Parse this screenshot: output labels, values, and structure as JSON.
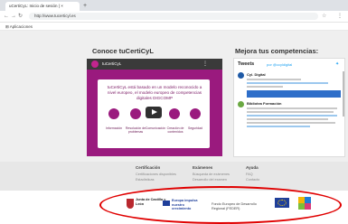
{
  "browser": {
    "tab_title": "uCertiCyL: Inicio de sesión | ×",
    "url": "http://www.tucerticyl.es",
    "bookmarks_label": "Aplicaciones"
  },
  "page": {
    "left_heading": "Conoce tuCertiCyL",
    "right_heading": "Mejora tus competencias:"
  },
  "video": {
    "channel": "tuCertiCyL",
    "description": "tuCertiCyL está basado en un modelo reconocido a nivel europeo, el modelo europeo de competencias digitales DIGCOMP",
    "competencies": [
      "Información",
      "Resolución de problemas",
      "Comunicación",
      "Creación de contenidos",
      "Seguridad"
    ]
  },
  "tweets": {
    "heading": "Tweets",
    "by": "por @ccyldigital",
    "accounts": [
      "Cyl. Digital",
      "Bibliotea Formación"
    ]
  },
  "footer": {
    "columns": [
      {
        "title": "Certificación",
        "links": [
          "Certificaciones disponibles",
          "Estadísticas"
        ]
      },
      {
        "title": "Exámenes",
        "links": [
          "Búsqueda de exámenes",
          "Desarrollo del examen"
        ]
      },
      {
        "title": "Ayuda",
        "links": [
          "FAQ",
          "Contacto"
        ]
      }
    ],
    "logos": {
      "jcyl": "Junta de Castilla y León",
      "esf": "Europa impulsa nuestro crecimiento",
      "fse": "Fondo Europeo de Desarrollo Regional (FEDER)"
    }
  },
  "colors": {
    "brand_magenta": "#9a1a7e",
    "highlight": "#e00000"
  }
}
